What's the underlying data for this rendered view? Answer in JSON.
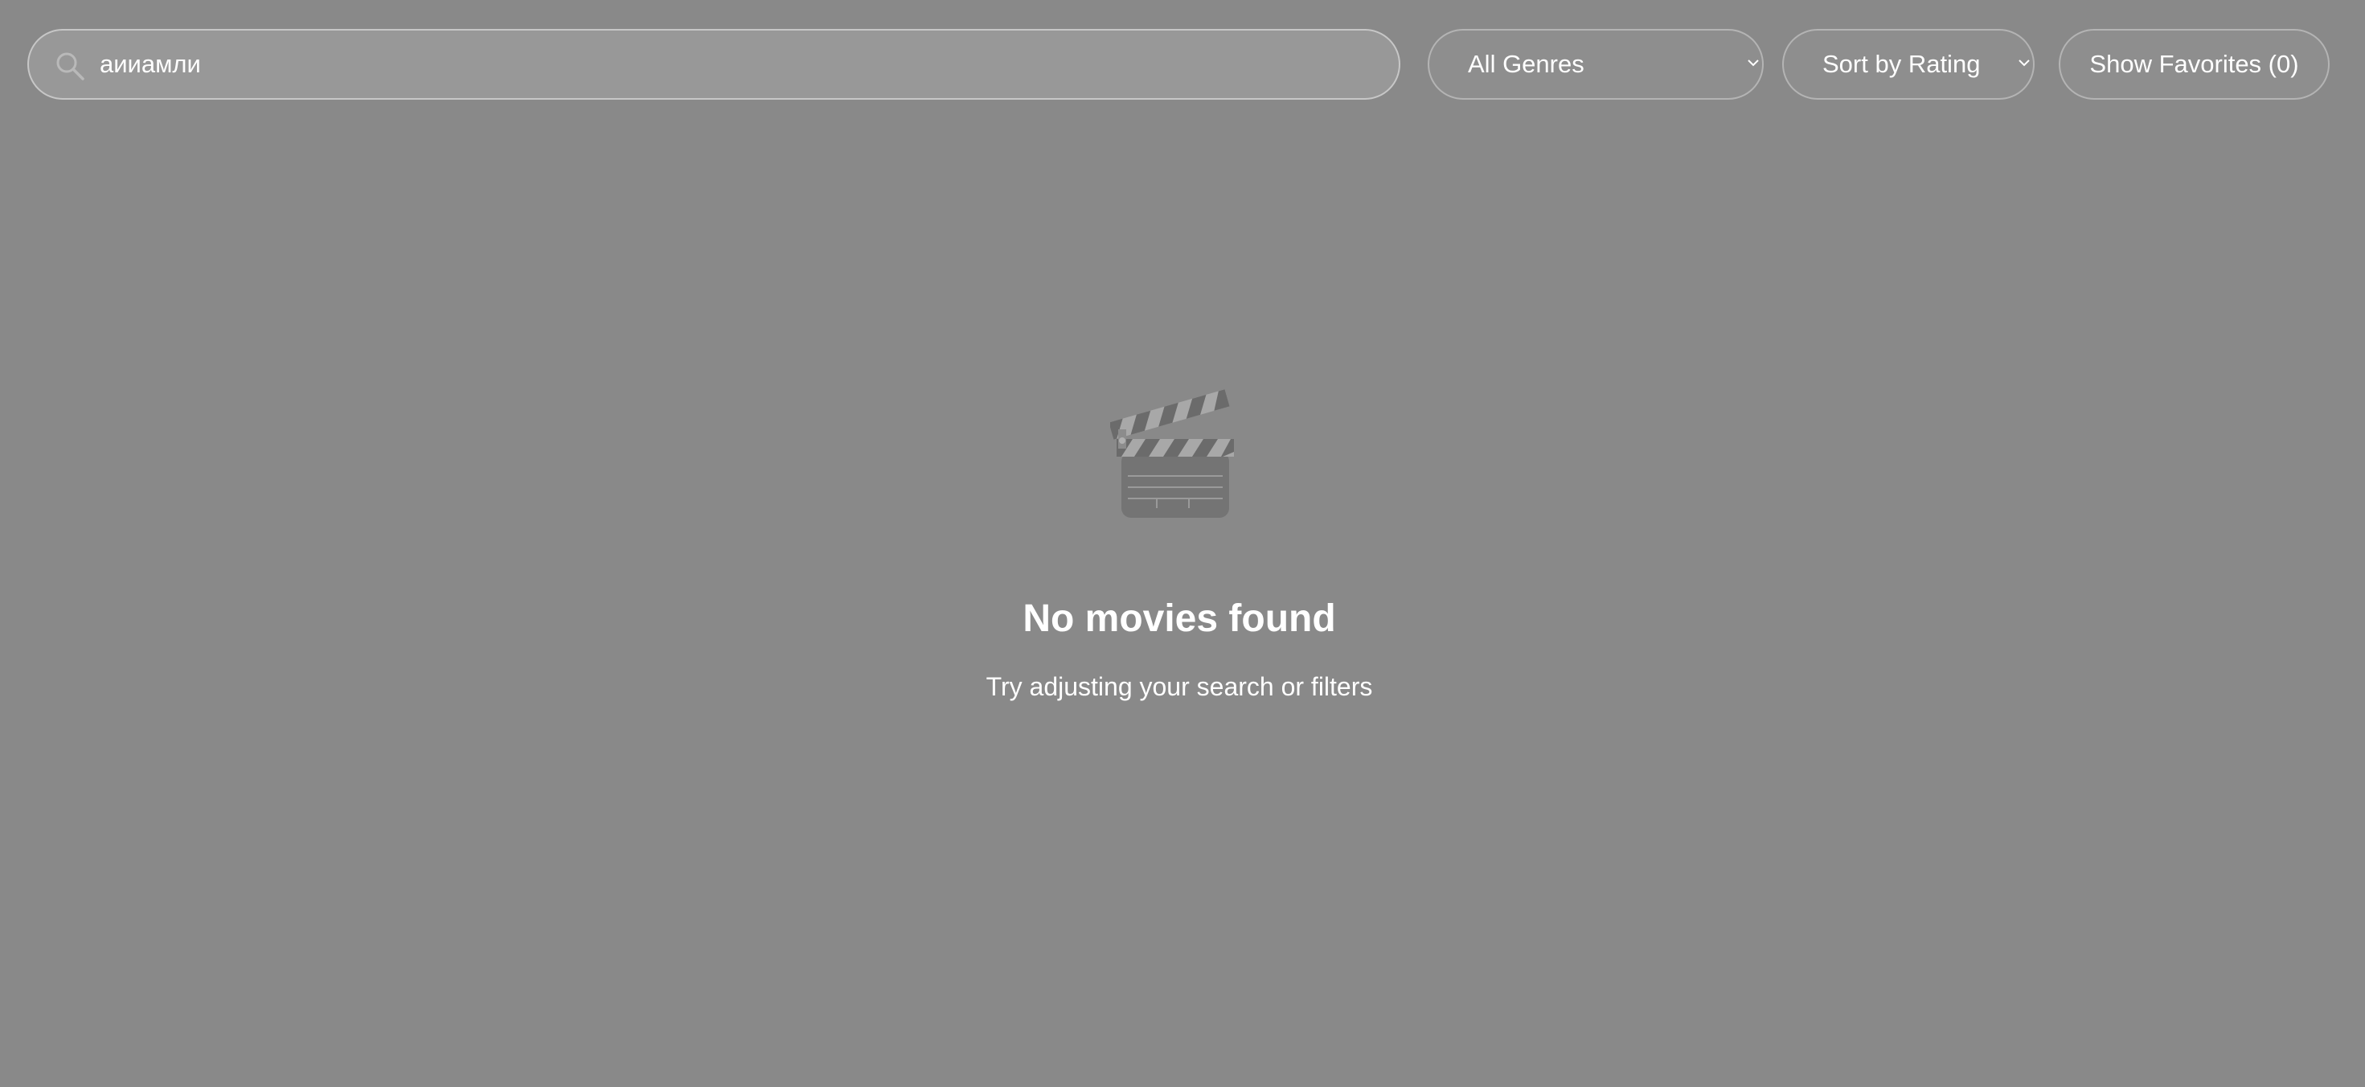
{
  "toolbar": {
    "search": {
      "value": "аииамли",
      "icon": "search-icon"
    },
    "genre_select": {
      "selected": "All Genres",
      "icon": "chevron-down-icon"
    },
    "sort_select": {
      "selected": "Sort by Rating",
      "icon": "chevron-down-icon"
    },
    "favorites_button": {
      "label": "Show Favorites (0)"
    }
  },
  "empty_state": {
    "icon": "clapperboard-icon",
    "title": "No movies found",
    "subtitle": "Try adjusting your search or filters"
  },
  "colors": {
    "background": "#898989",
    "text": "#ffffff",
    "border": "#c7c7c7"
  }
}
